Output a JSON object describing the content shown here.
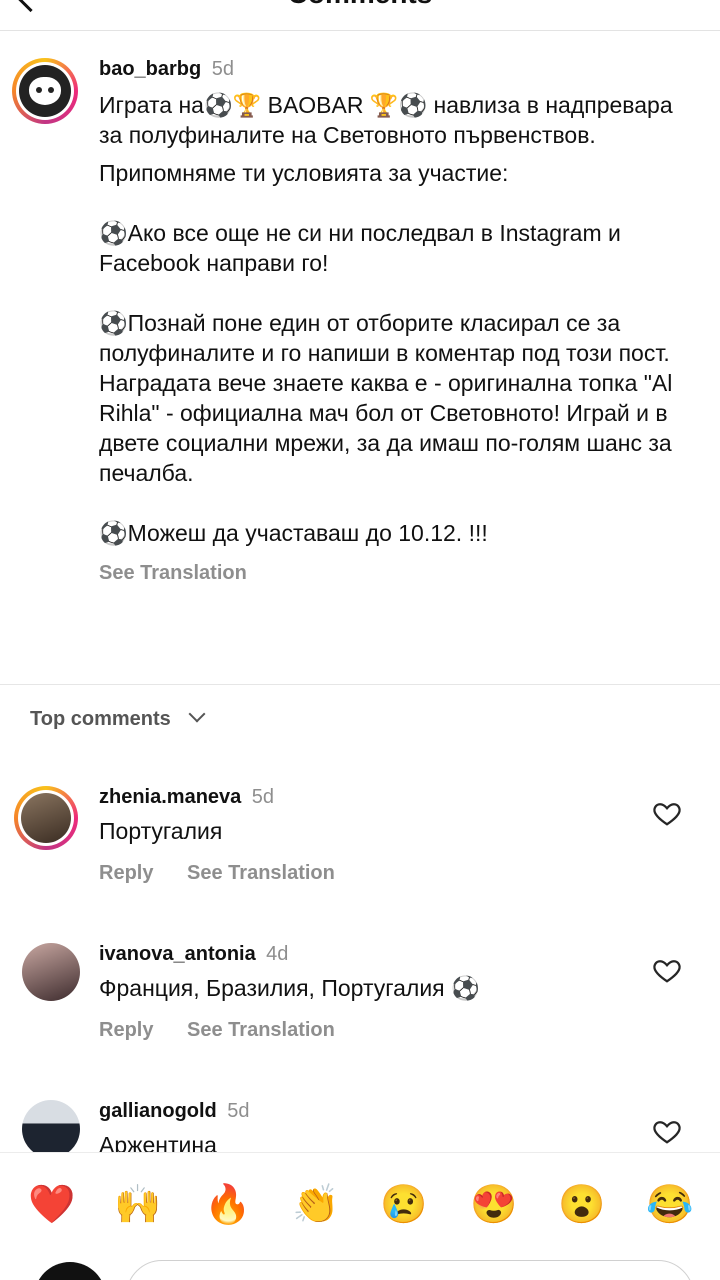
{
  "header": {
    "title": "Comments"
  },
  "caption": {
    "username": "bao_barbg",
    "time": "5d",
    "paragraphs": [
      "Играта на⚽🏆 BAOBAR 🏆⚽ навлиза в надпревара за полуфиналите на Световното първенствов.",
      "Припомняме ти условията за участие:",
      "",
      "⚽Ако все още не си ни последвал в Instagram и Facebook направи го!",
      "",
      "⚽Познай поне един от отборите класирал се за полуфиналите и го напиши в коментар под този пост. Наградата вече знаете каква е - оригинална топка \"Al Rihla\" - официална мач бол от Световното! Играй и в двете социални мрежи, за да имаш по-голям шанс за печалба.",
      "",
      "⚽Можеш да участаваш до 10.12. !!!"
    ],
    "see_translation": "See Translation"
  },
  "top_comments_label": "Top comments",
  "comments": [
    {
      "username": "zhenia.maneva",
      "time": "5d",
      "text": "Португалия",
      "reply": "Reply",
      "see_translation": "See Translation"
    },
    {
      "username": "ivanova_antonia",
      "time": "4d",
      "text": "Франция, Бразилия, Португалия ⚽",
      "reply": "Reply",
      "see_translation": "See Translation"
    },
    {
      "username": "gallianogold",
      "time": "5d",
      "text": "Аржентина"
    }
  ],
  "reactions": [
    "❤️",
    "🙌",
    "🔥",
    "👏",
    "😢",
    "😍",
    "😮",
    "😂"
  ],
  "colors": {
    "secondary_text": "#8e8e8e",
    "heart_red": "#e0245e"
  }
}
